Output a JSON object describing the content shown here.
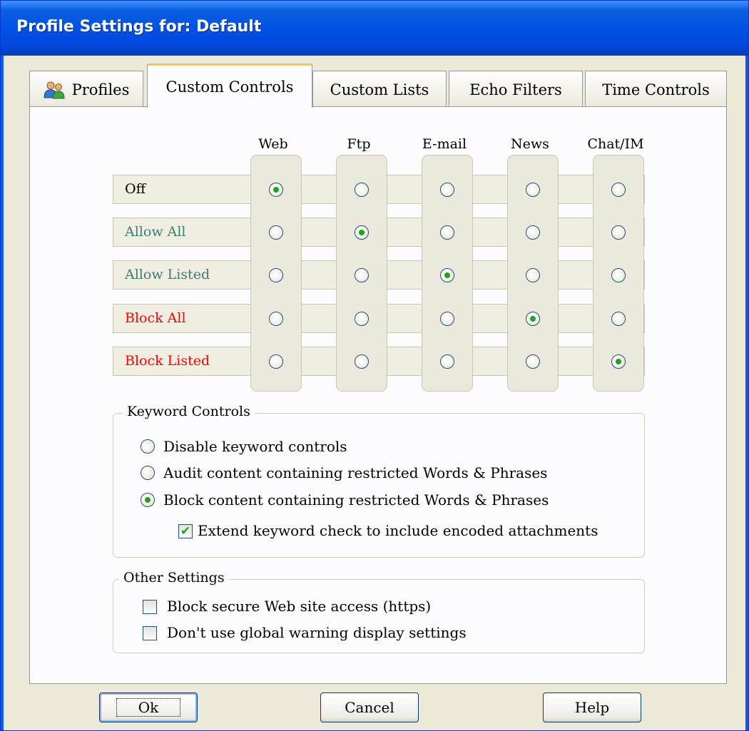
{
  "window": {
    "title": "Profile Settings for: Default"
  },
  "tabs": [
    {
      "label": "Profiles",
      "icon": "users-icon",
      "active": false
    },
    {
      "label": "Custom Controls",
      "active": true
    },
    {
      "label": "Custom Lists",
      "active": false
    },
    {
      "label": "Echo Filters",
      "active": false
    },
    {
      "label": "Time Controls",
      "active": false
    }
  ],
  "matrix": {
    "columns": [
      "Web",
      "Ftp",
      "E-mail",
      "News",
      "Chat/IM"
    ],
    "rows": [
      {
        "label": "Off",
        "color": "#000000"
      },
      {
        "label": "Allow All",
        "color": "#3b7f74"
      },
      {
        "label": "Allow Listed",
        "color": "#3b7f74"
      },
      {
        "label": "Block All",
        "color": "#ff0000"
      },
      {
        "label": "Block Listed",
        "color": "#ff0000"
      }
    ],
    "selected": {
      "Web": "Off",
      "Ftp": "Allow All",
      "E-mail": "Allow Listed",
      "News": "Block All",
      "Chat/IM": "Block Listed"
    }
  },
  "keyword_controls": {
    "title": "Keyword Controls",
    "options": [
      {
        "label": "Disable keyword controls",
        "selected": false
      },
      {
        "label": "Audit content containing restricted Words & Phrases",
        "selected": false
      },
      {
        "label": "Block content containing restricted Words & Phrases",
        "selected": true
      }
    ],
    "extend_check": {
      "label": "Extend keyword check to include encoded attachments",
      "checked": true
    }
  },
  "other_settings": {
    "title": "Other Settings",
    "items": [
      {
        "label": "Block secure Web site access (https)",
        "checked": false
      },
      {
        "label": "Don't use global warning display settings",
        "checked": false
      }
    ]
  },
  "buttons": {
    "ok": "Ok",
    "cancel": "Cancel",
    "help": "Help"
  },
  "colors": {
    "accent_green": "#21a121",
    "tab_highlight": "#ffc83c",
    "title_bar": "#0050e6"
  }
}
